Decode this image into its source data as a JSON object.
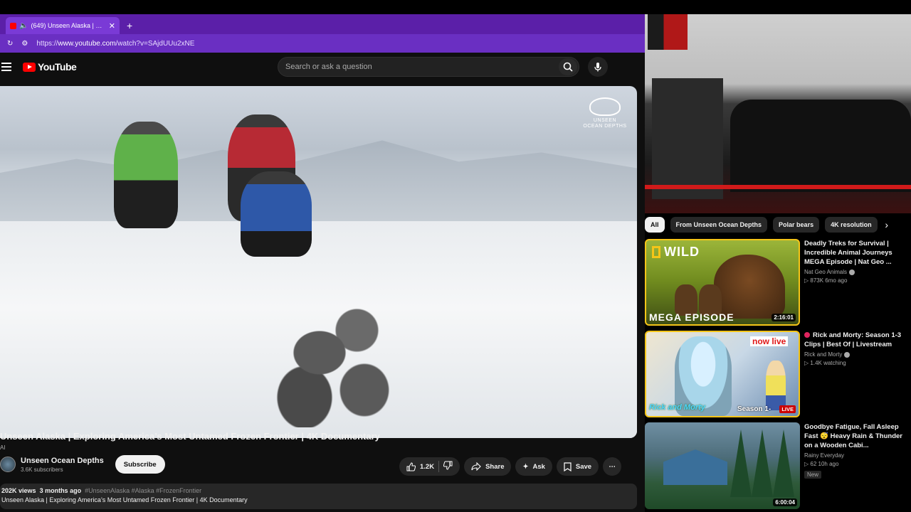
{
  "browser": {
    "tab_title": "(649) Unseen Alaska | Explorin",
    "url_prefix": "https://",
    "url_host": "www.youtube.com",
    "url_path": "/watch?v=SAjdUUu2xNE"
  },
  "header": {
    "logo_text": "YouTube",
    "search_placeholder": "Search or ask a question"
  },
  "video": {
    "watermark_line1": "UNSEEN",
    "watermark_line2": "OCEAN DEPTHS",
    "title": "Unseen Alaska | Exploring America’s Most Untamed Frozen Frontier | 4K Documentary",
    "ai_label": "AI",
    "channel_name": "Unseen Ocean Depths",
    "subscribers": "3.6K subscribers",
    "subscribe_label": "Subscribe",
    "likes": "1.2K",
    "share_label": "Share",
    "ask_label": "Ask",
    "save_label": "Save",
    "views": "202K views",
    "age": "3 months ago",
    "hashtags": "#UnseenAlaska #Alaska #FrozenFrontier",
    "description_line": "Unseen Alaska | Exploring America’s Most Untamed Frozen Frontier | 4K Documentary"
  },
  "chips": [
    "All",
    "From Unseen Ocean Depths",
    "Polar bears",
    "4K resolution"
  ],
  "recommendations": [
    {
      "title": "Deadly Treks for Survival | Incredible Animal Journeys MEGA Episode | Nat Geo ...",
      "channel": "Nat Geo Animals",
      "meta": "873K  6mo ago",
      "duration": "2:16:01",
      "thumb_text1": "WILD",
      "thumb_text2": "MEGA EPISODE"
    },
    {
      "title": "Rick and Morty: Season 1-3 Clips | Best Of | Livestream",
      "channel": "Rick and Morty",
      "meta": "1.4K watching",
      "badge": "LIVE",
      "thumb_text1": "now live",
      "thumb_text2": "Season 1-",
      "thumb_text3": "Rick and Morty"
    },
    {
      "title": "Goodbye Fatigue, Fall Asleep Fast 😴 Heavy Rain & Thunder on a Wooden Cabi...",
      "channel": "Rainy Everyday",
      "meta": "62  10h ago",
      "new_label": "New",
      "duration": "6:00:04"
    }
  ],
  "colors": {
    "tab_bar": "#5b1fa8",
    "youtube_red": "#ff0000",
    "page_bg": "#0f0f0f"
  }
}
